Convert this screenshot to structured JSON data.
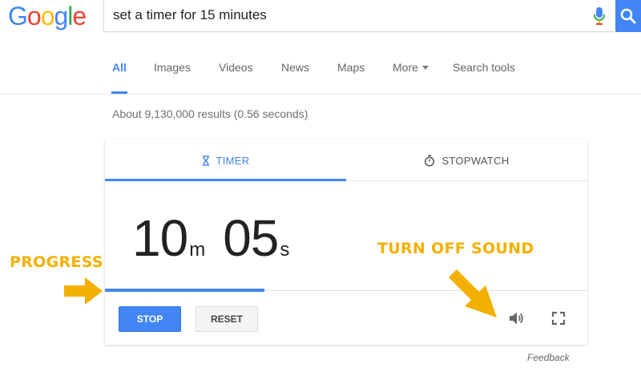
{
  "logo": {
    "letters": [
      "G",
      "o",
      "o",
      "g",
      "l",
      "e"
    ],
    "colors": [
      "#4285f4",
      "#ea4335",
      "#fbbc05",
      "#4285f4",
      "#34a853",
      "#ea4335"
    ]
  },
  "search": {
    "query": "set a timer for 15 minutes",
    "mic_icon": "mic-icon",
    "search_icon": "search-icon"
  },
  "tabs": [
    {
      "label": "All",
      "active": true
    },
    {
      "label": "Images"
    },
    {
      "label": "Videos"
    },
    {
      "label": "News"
    },
    {
      "label": "Maps"
    },
    {
      "label": "More"
    },
    {
      "label": "Search tools"
    }
  ],
  "result_stats": "About 9,130,000 results (0.56 seconds)",
  "timer_card": {
    "tabs": {
      "timer": "TIMER",
      "stopwatch": "STOPWATCH"
    },
    "minutes": "10",
    "minutes_unit": "m",
    "seconds": "05",
    "seconds_unit": "s",
    "progress": 0.33,
    "stop_label": "STOP",
    "reset_label": "RESET",
    "sound_icon": "speaker-icon",
    "fullscreen_icon": "fullscreen-icon"
  },
  "feedback": "Feedback",
  "annotations": {
    "progress": "PROGRESS",
    "sound": "TURN OFF SOUND",
    "color": "#f4b000"
  },
  "colors": {
    "accent": "#4285f4"
  }
}
